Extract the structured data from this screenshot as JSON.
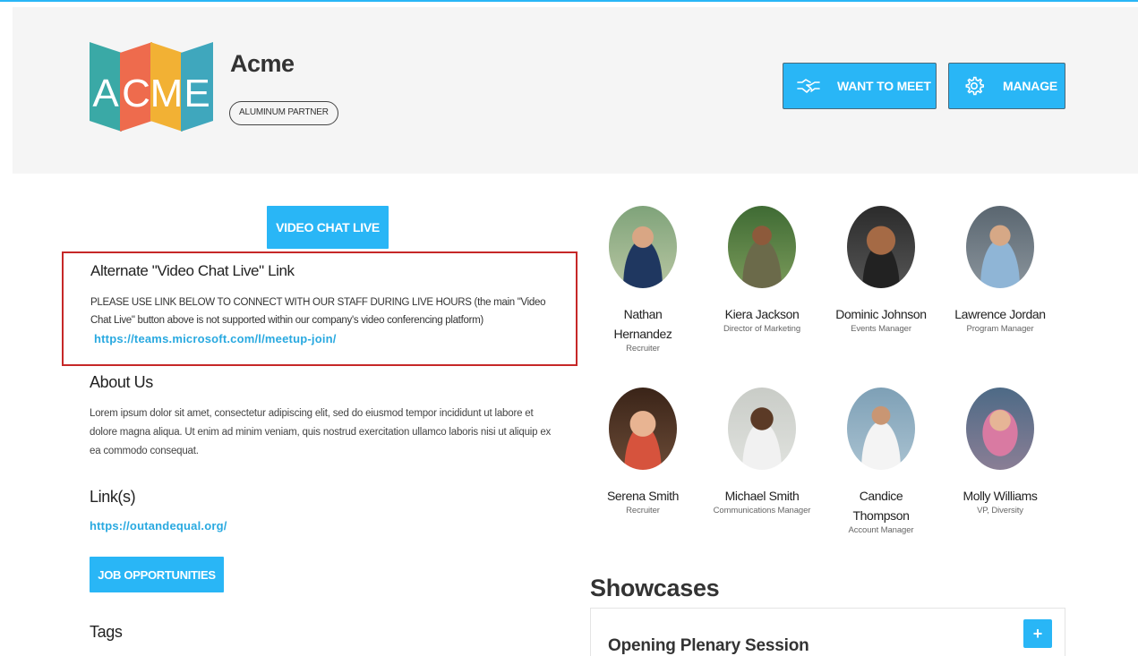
{
  "company": {
    "name": "Acme",
    "logo_letters": [
      "A",
      "C",
      "M",
      "E"
    ],
    "partner_badge": "ALUMINUM PARTNER"
  },
  "header_buttons": {
    "want_to_meet": "WANT TO MEET",
    "manage": "MANAGE"
  },
  "video_chat_button": "VIDEO CHAT LIVE",
  "alternate_link": {
    "title": "Alternate \"Video Chat Live\" Link",
    "text": "PLEASE USE LINK BELOW TO CONNECT WITH OUR STAFF DURING LIVE HOURS (the main \"Video Chat Live\" button above is not supported within our company's video conferencing platform)",
    "url": "https://teams.microsoft.com/l/meetup-join/"
  },
  "about": {
    "title": "About Us",
    "text": "Lorem ipsum dolor sit amet, consectetur adipiscing elit, sed do eiusmod tempor incididunt ut labore et dolore magna aliqua. Ut enim ad minim veniam, quis nostrud exercitation ullamco laboris nisi ut aliquip ex ea commodo consequat."
  },
  "links": {
    "title": "Link(s)",
    "url": "https://outandequal.org/"
  },
  "job_button": "JOB OPPORTUNITIES",
  "tags_title": "Tags",
  "staff": [
    {
      "name": "Nathan Hernandez",
      "role": "Recruiter"
    },
    {
      "name": "Kiera Jackson",
      "role": "Director of Marketing"
    },
    {
      "name": "Dominic Johnson",
      "role": "Events Manager"
    },
    {
      "name": "Lawrence Jordan",
      "role": "Program Manager"
    },
    {
      "name": "Serena Smith",
      "role": "Recruiter"
    },
    {
      "name": "Michael Smith",
      "role": "Communications Manager"
    },
    {
      "name": "Candice Thompson",
      "role": "Account Manager"
    },
    {
      "name": "Molly Williams",
      "role": "VP, Diversity"
    }
  ],
  "showcases": {
    "title": "Showcases",
    "items": [
      {
        "name": "Opening Plenary Session"
      }
    ],
    "add_label": "+"
  },
  "colors": {
    "accent": "#29b6f6",
    "link": "#29a9e0",
    "highlight_border": "#c62828",
    "header_bg": "#f5f5f5"
  }
}
